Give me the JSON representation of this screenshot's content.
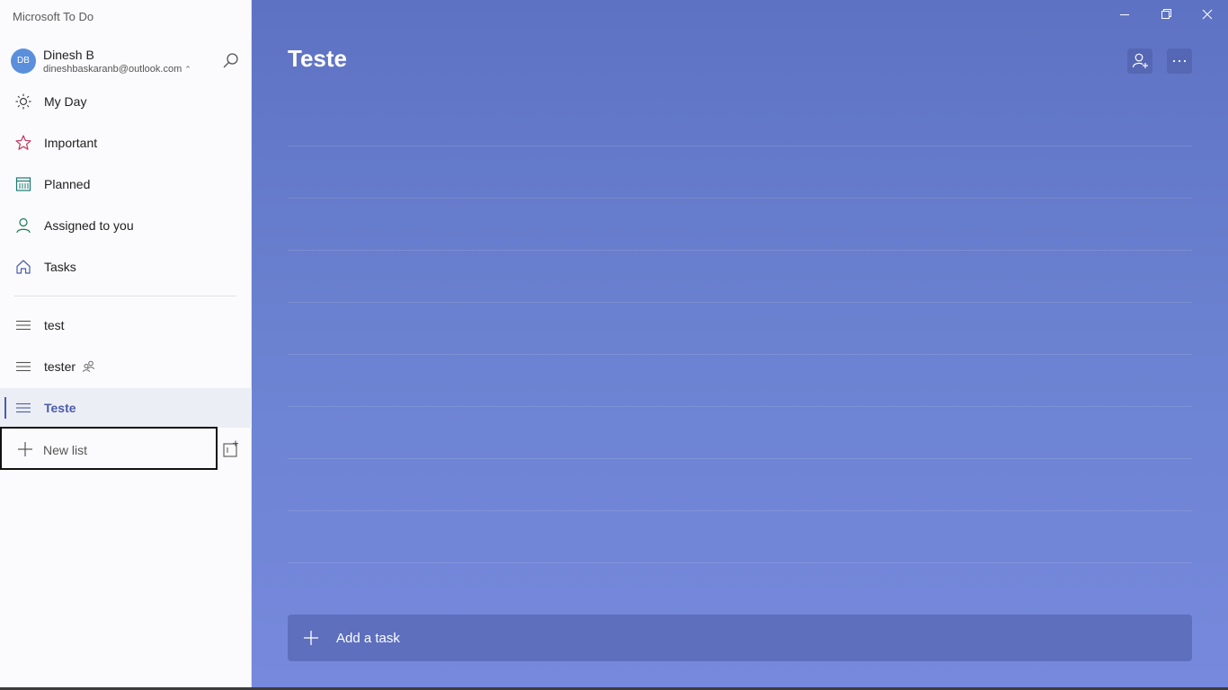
{
  "app": {
    "title": "Microsoft To Do"
  },
  "account": {
    "initials": "DB",
    "name": "Dinesh B",
    "email": "dineshbaskaranb@outlook.com"
  },
  "nav": [
    {
      "label": "My Day",
      "icon": "sun-icon"
    },
    {
      "label": "Important",
      "icon": "star-icon"
    },
    {
      "label": "Planned",
      "icon": "calendar-icon"
    },
    {
      "label": "Assigned to you",
      "icon": "person-icon"
    },
    {
      "label": "Tasks",
      "icon": "home-icon"
    }
  ],
  "lists": [
    {
      "label": "test",
      "shared": false,
      "selected": false
    },
    {
      "label": "tester",
      "shared": true,
      "selected": false
    },
    {
      "label": "Teste",
      "shared": false,
      "selected": true
    }
  ],
  "new_list": {
    "label": "New list"
  },
  "main": {
    "title": "Teste",
    "add_task_label": "Add a task"
  },
  "colors": {
    "accent": "#4b5ca8",
    "background_top": "#5e72c3",
    "background_bottom": "#7789dd",
    "important_star": "#c43a5e",
    "planned_calendar": "#1a7a6f",
    "assigned_person": "#1a7a4f"
  }
}
